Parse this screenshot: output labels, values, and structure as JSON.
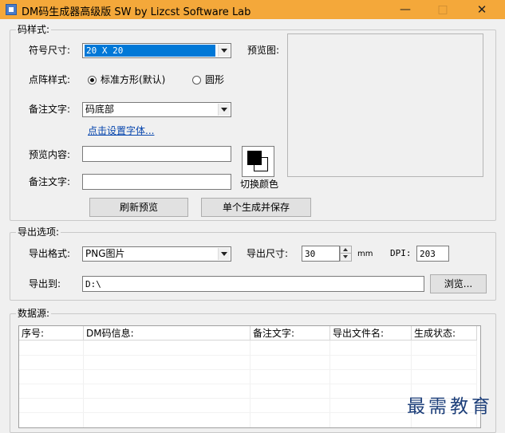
{
  "window": {
    "title": "DM码生成器高级版 SW  by Lizcst Software Lab",
    "minimize_glyph": "—",
    "maximize_glyph": "□",
    "close_glyph": "✕",
    "titlebar_color": "#f4a83a"
  },
  "code_style": {
    "group_title": "码样式:",
    "symbol_size_label": "符号尺寸:",
    "symbol_size_value": "20 X 20",
    "dot_style_label": "点阵样式:",
    "dot_style_options": [
      "标准方形(默认)",
      "圆形"
    ],
    "dot_style_selected": "标准方形(默认)",
    "note_text_label": "备注文字:",
    "note_text_value": "码底部",
    "set_font_link": "点击设置字体...",
    "preview_content_label": "预览内容:",
    "preview_content_value": "",
    "note_text2_label": "备注文字:",
    "note_text2_value": "",
    "switch_color_label": "切换颜色",
    "preview_label": "预览图:",
    "refresh_button": "刷新预览",
    "generate_save_button": "单个生成并保存"
  },
  "export": {
    "group_title": "导出选项:",
    "format_label": "导出格式:",
    "format_value": "PNG图片",
    "size_label": "导出尺寸:",
    "size_value": "30",
    "size_unit": "mm",
    "dpi_label": "DPI:",
    "dpi_value": "203",
    "export_to_label": "导出到:",
    "export_to_value": "D:\\",
    "browse_button": "浏览..."
  },
  "datasource": {
    "group_title": "数据源:",
    "columns": [
      "序号:",
      "DM码信息:",
      "备注文字:",
      "导出文件名:",
      "生成状态:"
    ],
    "rows": []
  },
  "watermark": "最需教育"
}
